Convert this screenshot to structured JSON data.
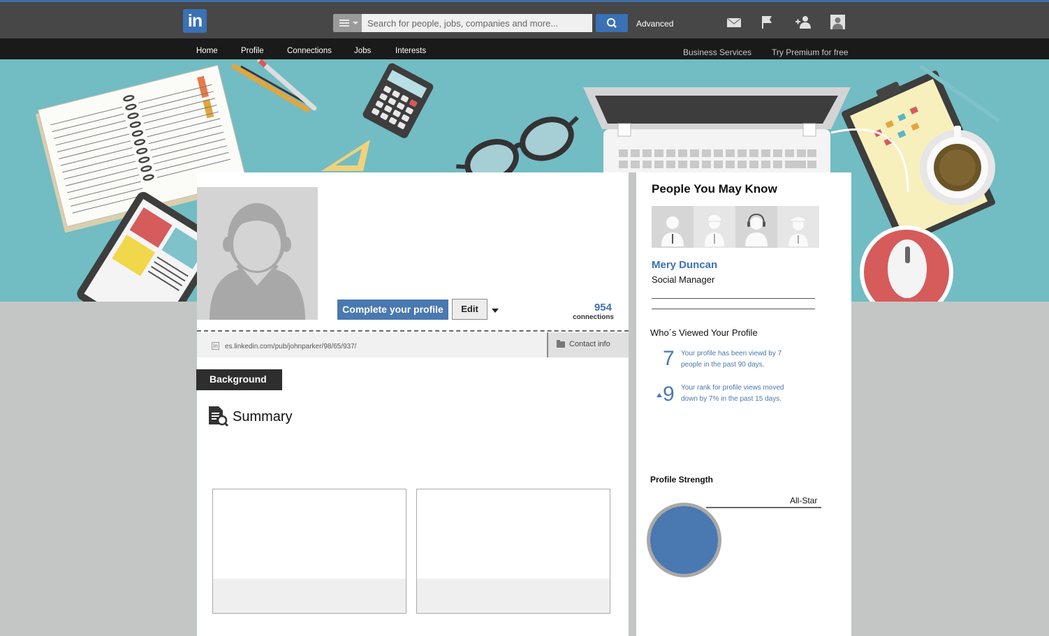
{
  "colors": {
    "brand": "#3a71b5",
    "accent": "#4a78b0",
    "banner": "#72bcc4",
    "topbar": "#474747",
    "navbar": "#1a1a1a"
  },
  "header": {
    "logo_text": "in",
    "search_placeholder": "Search for people, jobs, companies and more...",
    "advanced_label": "Advanced",
    "icons": [
      "mail-icon",
      "flag-icon",
      "add-connection-icon",
      "account-icon"
    ]
  },
  "nav": {
    "items": [
      "Home",
      "Profile",
      "Connections",
      "Jobs",
      "Interests"
    ],
    "business_services": "Business Services",
    "premium": "Try Premium for free"
  },
  "profile": {
    "complete_label": "Complete your profile",
    "edit_label": "Edit",
    "connections_count": "954",
    "connections_label": "connections",
    "public_url": "es.linkedin.com/pub/johnparker/98/65/937/",
    "contact_info_label": "Contact info"
  },
  "background": {
    "tab_label": "Background",
    "summary_title": "Summary"
  },
  "sidebar": {
    "pymk_title": "People You May Know",
    "person_name": "Mery Duncan",
    "person_title": "Social Manager",
    "who_viewed_title": "Who´s Viewed Your Profile",
    "views_count": "7",
    "views_text": "Your profile has been viewd by 7 people in the past 90 days.",
    "rank_value": "9",
    "rank_text": "Your rank for profile views moved down by 7% in the past 15 days.",
    "strength_title": "Profile Strength",
    "strength_level": "All-Star"
  }
}
